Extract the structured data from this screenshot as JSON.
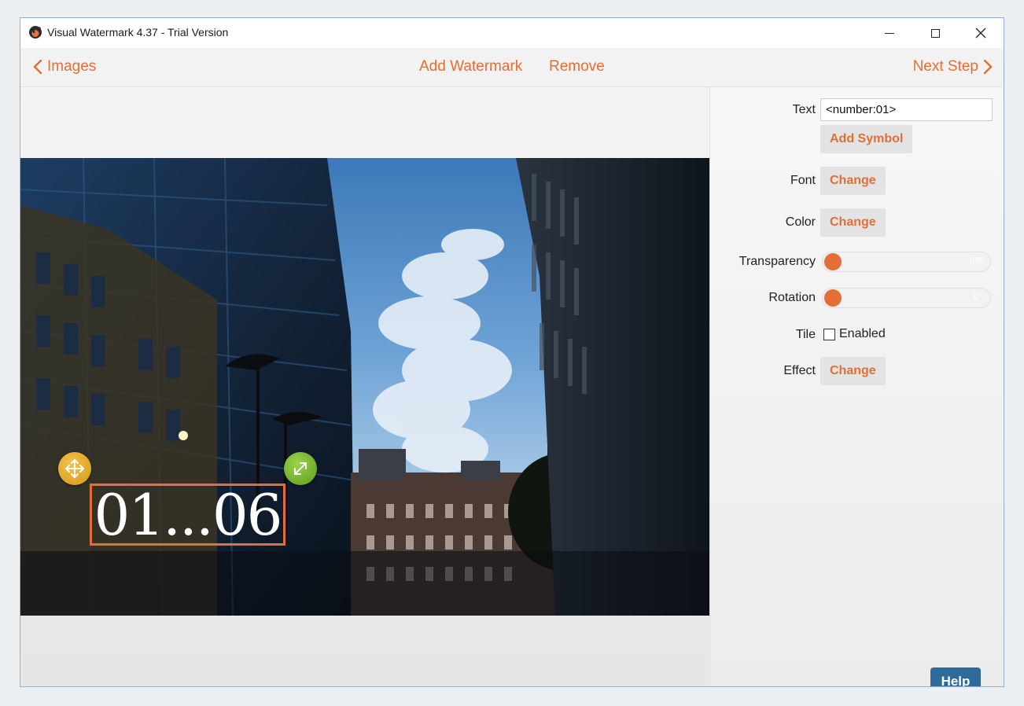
{
  "window": {
    "title": "Visual Watermark 4.37 - Trial Version"
  },
  "nav": {
    "back_label": "Images",
    "add_watermark_label": "Add Watermark",
    "remove_label": "Remove",
    "next_label": "Next Step"
  },
  "canvas": {
    "watermark_text": "01...06"
  },
  "panel": {
    "text_label": "Text",
    "text_value": "<number:01>",
    "add_symbol_label": "Add Symbol",
    "font_label": "Font",
    "font_button": "Change",
    "color_label": "Color",
    "color_button": "Change",
    "transparency_label": "Transparency",
    "transparency_value": "0%",
    "rotation_label": "Rotation",
    "rotation_value": "0°",
    "tile_label": "Tile",
    "tile_checkbox_label": "Enabled",
    "tile_enabled": false,
    "effect_label": "Effect",
    "effect_button": "Change",
    "help_label": "Help"
  },
  "colors": {
    "accent": "#e46f36",
    "help_button": "#2f6b9a"
  }
}
